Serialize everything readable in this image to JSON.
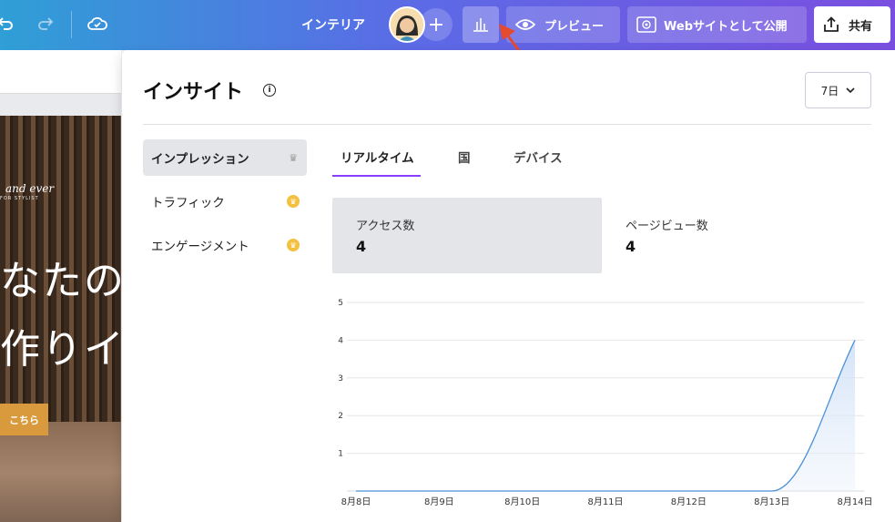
{
  "topbar": {
    "doc_title": "インテリア",
    "preview_label": "プレビュー",
    "publish_label": "Webサイトとして公開",
    "share_label": "共有",
    "icons": [
      "undo-icon",
      "redo-icon",
      "cloud-saved-icon",
      "plus-icon",
      "bar-chart-icon",
      "eye-icon",
      "web-publish-icon",
      "upload-icon"
    ]
  },
  "canvas": {
    "script_text": "and ever",
    "small_caps": "FOR STYLIST",
    "headline_1": "なたの",
    "headline_2": "作りイ",
    "cta": "こちら"
  },
  "panel": {
    "title": "インサイト",
    "period": "7日",
    "sidebar": [
      {
        "label": "インプレッション",
        "active": true,
        "crown": "gray"
      },
      {
        "label": "トラフィック",
        "active": false,
        "crown": "gold"
      },
      {
        "label": "エンゲージメント",
        "active": false,
        "crown": "gold"
      }
    ],
    "tabs": [
      {
        "label": "リアルタイム",
        "active": true
      },
      {
        "label": "国",
        "active": false
      },
      {
        "label": "デバイス",
        "active": false
      }
    ],
    "stats": [
      {
        "label": "アクセス数",
        "value": "4"
      },
      {
        "label": "ページビュー数",
        "value": "4"
      }
    ]
  },
  "colors": {
    "accent": "#8b3dff",
    "line": "#4a90d9",
    "crown_gold": "#f4c042"
  },
  "chart_data": {
    "type": "area",
    "x": [
      "8月8日",
      "8月9日",
      "8月10日",
      "8月11日",
      "8月12日",
      "8月13日",
      "8月14日"
    ],
    "values": [
      0,
      0,
      0,
      0,
      0,
      0,
      4
    ],
    "yticks": [
      1,
      2,
      3,
      4,
      5
    ],
    "ylim": [
      0,
      5
    ],
    "grid": true
  }
}
